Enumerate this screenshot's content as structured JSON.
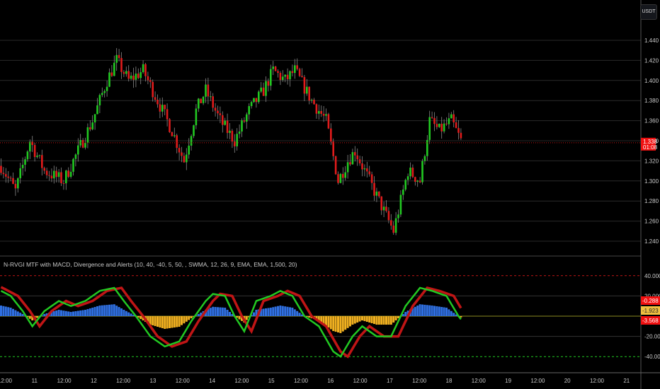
{
  "currency_button": "USDT",
  "indicator_legend": "N-RVGI MTF with MACD, Divergence and Alerts (10, 40, -40, 5, 50, , SWMA, 12, 26, 9, EMA, EMA, 1,500, 20)",
  "colors": {
    "up": "#22c922",
    "down": "#e01b1b",
    "hist_pos": "#2f6fe0",
    "hist_neg": "#f0b020",
    "signal_green": "#22c922",
    "signal_red": "#c01515"
  },
  "chart_data": [
    {
      "type": "candlestick",
      "title": "Price",
      "ylim": [
        1.23,
        1.46
      ],
      "yticks": [
        "1.440",
        "1.420",
        "1.400",
        "1.380",
        "1.360",
        "1.340",
        "1.320",
        "1.300",
        "1.280",
        "1.260",
        "1.240"
      ],
      "last_price": "1.338",
      "countdown": "01:08",
      "close_keypoints": [
        [
          0,
          1.315
        ],
        [
          6,
          1.29
        ],
        [
          12,
          1.34
        ],
        [
          18,
          1.31
        ],
        [
          26,
          1.3
        ],
        [
          32,
          1.33
        ],
        [
          38,
          1.36
        ],
        [
          44,
          1.4
        ],
        [
          48,
          1.42
        ],
        [
          53,
          1.4
        ],
        [
          59,
          1.41
        ],
        [
          65,
          1.38
        ],
        [
          71,
          1.35
        ],
        [
          76,
          1.32
        ],
        [
          81,
          1.37
        ],
        [
          85,
          1.39
        ],
        [
          91,
          1.36
        ],
        [
          97,
          1.34
        ],
        [
          103,
          1.37
        ],
        [
          109,
          1.39
        ],
        [
          113,
          1.41
        ],
        [
          118,
          1.4
        ],
        [
          122,
          1.41
        ],
        [
          129,
          1.38
        ],
        [
          135,
          1.36
        ],
        [
          140,
          1.3
        ],
        [
          144,
          1.32
        ],
        [
          147,
          1.33
        ],
        [
          153,
          1.3
        ],
        [
          159,
          1.27
        ],
        [
          163,
          1.25
        ],
        [
          166,
          1.28
        ],
        [
          169,
          1.31
        ],
        [
          174,
          1.3
        ],
        [
          176,
          1.33
        ],
        [
          178,
          1.36
        ],
        [
          182,
          1.35
        ],
        [
          187,
          1.36
        ],
        [
          191,
          1.34
        ]
      ]
    },
    {
      "type": "oscillator",
      "ylim": [
        -48,
        48
      ],
      "yticks": [
        "40.000",
        "20.000",
        "-20.000",
        "-40.000"
      ],
      "value_labels": [
        "-0.288",
        "-1.923",
        "-3.568"
      ],
      "osc_keypoints": [
        [
          0,
          25
        ],
        [
          4,
          20
        ],
        [
          9,
          5
        ],
        [
          13,
          -10
        ],
        [
          18,
          5
        ],
        [
          24,
          15
        ],
        [
          29,
          10
        ],
        [
          35,
          15
        ],
        [
          41,
          25
        ],
        [
          47,
          28
        ],
        [
          51,
          15
        ],
        [
          56,
          0
        ],
        [
          62,
          -20
        ],
        [
          68,
          -30
        ],
        [
          74,
          -25
        ],
        [
          79,
          -5
        ],
        [
          85,
          15
        ],
        [
          88,
          22
        ],
        [
          93,
          20
        ],
        [
          97,
          0
        ],
        [
          101,
          -15
        ],
        [
          106,
          15
        ],
        [
          112,
          20
        ],
        [
          116,
          25
        ],
        [
          121,
          20
        ],
        [
          126,
          0
        ],
        [
          132,
          -10
        ],
        [
          138,
          -35
        ],
        [
          141,
          -40
        ],
        [
          146,
          -20
        ],
        [
          150,
          -10
        ],
        [
          156,
          -20
        ],
        [
          162,
          -20
        ],
        [
          168,
          10
        ],
        [
          174,
          28
        ],
        [
          179,
          25
        ],
        [
          185,
          20
        ],
        [
          190,
          0
        ],
        [
          191,
          -3
        ]
      ]
    }
  ],
  "time_axis": [
    "12:00",
    "11",
    "12:00",
    "12",
    "12:00",
    "13",
    "12:00",
    "14",
    "12:00",
    "15",
    "12:00",
    "16",
    "12:00",
    "17",
    "12:00",
    "18",
    "12:00",
    "19",
    "12:00",
    "20",
    "12:00",
    "21"
  ]
}
